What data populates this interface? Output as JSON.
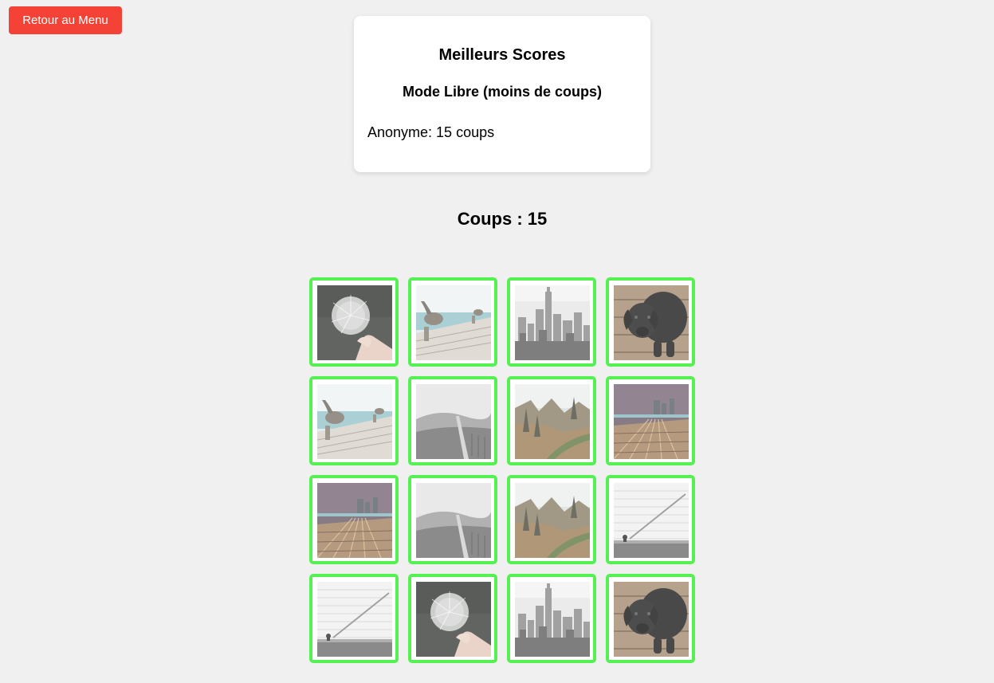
{
  "back_button": {
    "label": "Retour au Menu"
  },
  "scores": {
    "title": "Meilleurs Scores",
    "mode": "Mode Libre (moins de coups)",
    "entries": [
      {
        "text": "Anonyme: 15 coups"
      }
    ]
  },
  "moves": {
    "text": "Coups : 15"
  },
  "colors": {
    "back_button": "#f44336",
    "matched_border": "#55f052",
    "background": "#f0f0f0"
  },
  "board": {
    "rows": 4,
    "cols": 4,
    "cards": [
      {
        "image": "dandelion",
        "matched": true
      },
      {
        "image": "pelican-pier",
        "matched": true
      },
      {
        "image": "city-skyline",
        "matched": true
      },
      {
        "image": "black-dog",
        "matched": true
      },
      {
        "image": "pelican-pier",
        "matched": true
      },
      {
        "image": "hills-path",
        "matched": true
      },
      {
        "image": "autumn-forest",
        "matched": true
      },
      {
        "image": "railway-dusk",
        "matched": true
      },
      {
        "image": "railway-dusk",
        "matched": true
      },
      {
        "image": "hills-path",
        "matched": true
      },
      {
        "image": "autumn-forest",
        "matched": true
      },
      {
        "image": "white-wall-stairs",
        "matched": true
      },
      {
        "image": "white-wall-stairs",
        "matched": true
      },
      {
        "image": "dandelion",
        "matched": true
      },
      {
        "image": "city-skyline",
        "matched": true
      },
      {
        "image": "black-dog",
        "matched": true
      }
    ]
  }
}
